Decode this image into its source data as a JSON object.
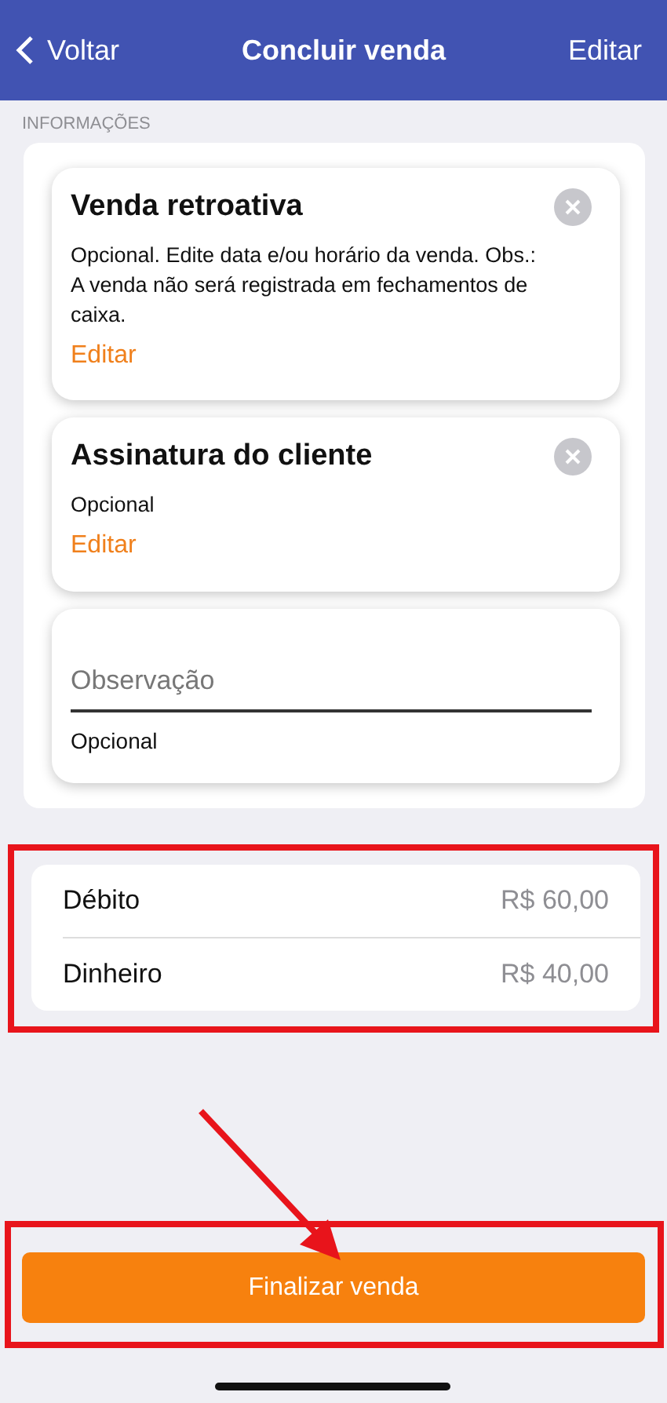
{
  "header": {
    "back": "Voltar",
    "title": "Concluir venda",
    "action": "Editar"
  },
  "section_label": "INFORMAÇÕES",
  "cards": [
    {
      "kind": "option",
      "title": "Venda retroativa",
      "description": "Opcional. Edite data e/ou horário da venda. Obs.: A venda não será registrada em fechamentos de caixa.",
      "link": "Editar"
    },
    {
      "kind": "option",
      "title": "Assinatura do cliente",
      "description": "Opcional",
      "link": "Editar"
    },
    {
      "kind": "field",
      "placeholder": "Observação",
      "hint": "Opcional"
    }
  ],
  "payments": [
    {
      "method": "Débito",
      "amount": "R$ 60,00"
    },
    {
      "method": "Dinheiro",
      "amount": "R$ 40,00"
    }
  ],
  "finish_button": "Finalizar venda"
}
